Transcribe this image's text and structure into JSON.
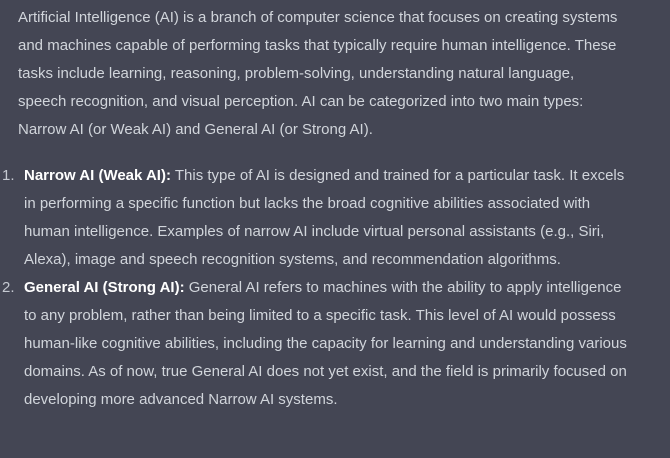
{
  "message": {
    "intro": "Artificial Intelligence (AI) is a branch of computer science that focuses on creating systems and machines capable of performing tasks that typically require human intelligence. These tasks include learning, reasoning, problem-solving, understanding natural language, speech recognition, and visual perception. AI can be categorized into two main types: Narrow AI (or Weak AI) and General AI (or Strong AI).",
    "items": [
      {
        "number": "1.",
        "term": "Narrow AI (Weak AI):",
        "text": " This type of AI is designed and trained for a particular task. It excels in performing a specific function but lacks the broad cognitive abilities associated with human intelligence. Examples of narrow AI include virtual personal assistants (e.g., Siri, Alexa), image and speech recognition systems, and recommendation algorithms."
      },
      {
        "number": "2.",
        "term": "General AI (Strong AI):",
        "text": " General AI refers to machines with the ability to apply intelligence to any problem, rather than being limited to a specific task. This level of AI would possess human-like cognitive abilities, including the capacity for learning and understanding various domains. As of now, true General AI does not yet exist, and the field is primarily focused on developing more advanced Narrow AI systems."
      }
    ]
  },
  "colors": {
    "background": "#444654",
    "text": "#d1d5db",
    "term": "#ffffff"
  }
}
